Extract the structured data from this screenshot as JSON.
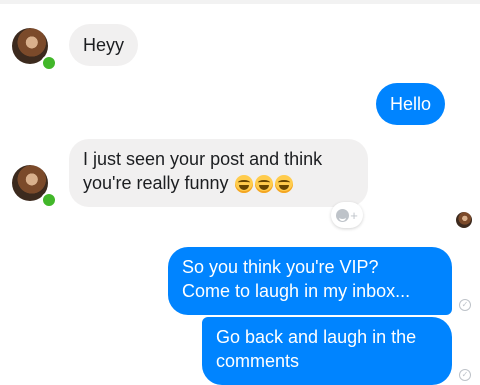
{
  "messages": [
    {
      "side": "incoming",
      "text": "Heyy"
    },
    {
      "side": "outgoing",
      "text": "Hello"
    },
    {
      "side": "incoming",
      "line1": "I just seen your post and think",
      "line2": "you're really funny",
      "emoji": "rolling-laughing-emoji"
    },
    {
      "side": "outgoing",
      "line1": "So you think you're VIP?",
      "line2": "Come to laugh in my inbox..."
    },
    {
      "side": "outgoing",
      "line1": "Go back and laugh in the",
      "line2": "comments"
    }
  ],
  "icons": {
    "online_indicator": "online-dot",
    "reaction_add": "add-reaction-icon",
    "read_status": "sent-check-icon"
  },
  "react_plus": "+",
  "check_glyph": "✓",
  "colors": {
    "outgoing_bubble": "#0084ff",
    "incoming_bubble": "#f1f0f0",
    "online": "#42b72a"
  }
}
